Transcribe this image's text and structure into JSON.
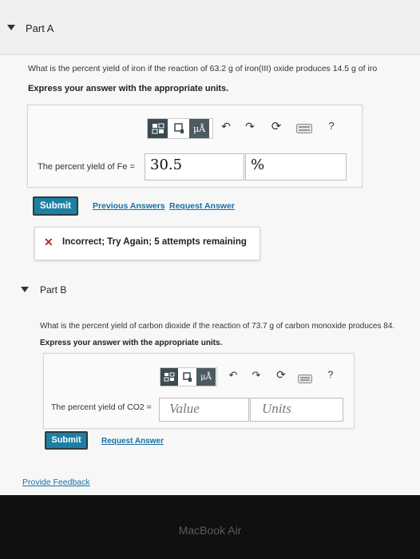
{
  "part_a": {
    "title": "Part A",
    "question": "What is the percent yield of iron if the reaction of 63.2 g of iron(III) oxide produces 14.5 g of iro",
    "instruction": "Express your answer with the appropriate units.",
    "field_label": "The percent yield of Fe =",
    "value": "30.5",
    "units": "%",
    "submit_label": "Submit",
    "previous_answers_label": "Previous Answers",
    "request_answer_label": "Request Answer",
    "feedback_text": "Incorrect; Try Again; 5 attempts remaining"
  },
  "part_b": {
    "title": "Part B",
    "question": "What is the percent yield of carbon dioxide if the reaction of 73.7 g of carbon monoxide produces 84.",
    "instruction": "Express your answer with the appropriate units.",
    "field_label": "The percent yield of CO2 =",
    "value_placeholder": "Value",
    "units_placeholder": "Units",
    "submit_label": "Submit",
    "request_answer_label": "Request Answer"
  },
  "toolbar": {
    "mu_label": "μÅ",
    "help_label": "?"
  },
  "provide_feedback_label": "Provide Feedback",
  "laptop_brand": "MacBook Air",
  "colors": {
    "submit_bg": "#1e7fa3",
    "link": "#1a6fa3",
    "error": "#c4282d",
    "toolbar_dark": "#3c4a52"
  }
}
